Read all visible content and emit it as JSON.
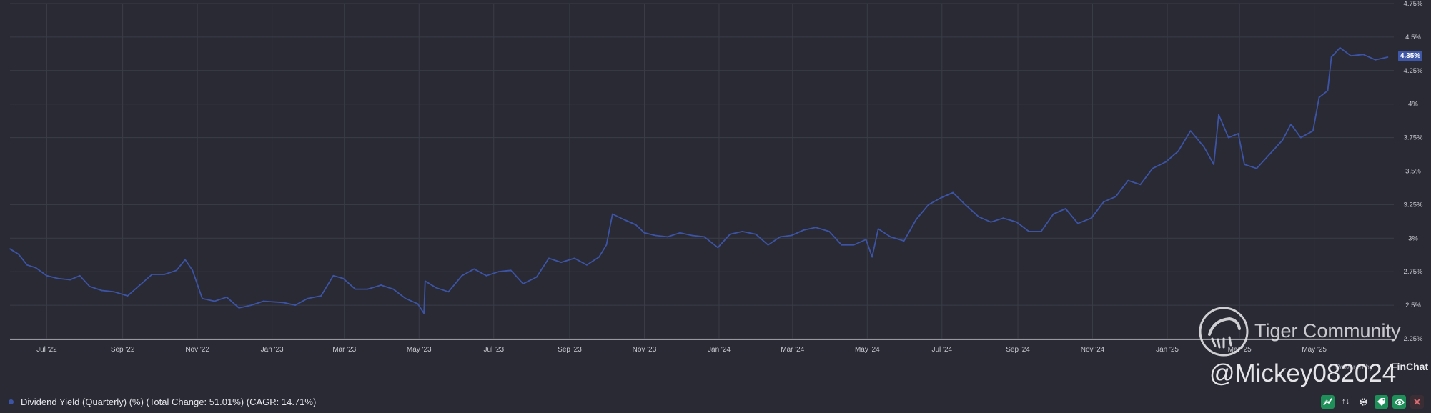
{
  "chart_data": {
    "type": "line",
    "series": [
      {
        "name": "Dividend Yield (Quarterly) (%)",
        "color": "#3d54a6",
        "points": [
          [
            "2022-06-01",
            2.92
          ],
          [
            "2022-06-08",
            2.88
          ],
          [
            "2022-06-15",
            2.8
          ],
          [
            "2022-06-22",
            2.78
          ],
          [
            "2022-07-01",
            2.72
          ],
          [
            "2022-07-10",
            2.7
          ],
          [
            "2022-07-20",
            2.69
          ],
          [
            "2022-07-28",
            2.72
          ],
          [
            "2022-08-05",
            2.64
          ],
          [
            "2022-08-15",
            2.61
          ],
          [
            "2022-08-25",
            2.6
          ],
          [
            "2022-09-05",
            2.57
          ],
          [
            "2022-09-15",
            2.65
          ],
          [
            "2022-09-25",
            2.73
          ],
          [
            "2022-10-05",
            2.73
          ],
          [
            "2022-10-15",
            2.76
          ],
          [
            "2022-10-22",
            2.84
          ],
          [
            "2022-10-28",
            2.76
          ],
          [
            "2022-11-05",
            2.55
          ],
          [
            "2022-11-15",
            2.53
          ],
          [
            "2022-11-25",
            2.56
          ],
          [
            "2022-12-05",
            2.48
          ],
          [
            "2022-12-15",
            2.5
          ],
          [
            "2022-12-25",
            2.53
          ],
          [
            "2023-01-10",
            2.52
          ],
          [
            "2023-01-20",
            2.5
          ],
          [
            "2023-01-30",
            2.55
          ],
          [
            "2023-02-10",
            2.57
          ],
          [
            "2023-02-20",
            2.72
          ],
          [
            "2023-02-28",
            2.7
          ],
          [
            "2023-03-10",
            2.62
          ],
          [
            "2023-03-20",
            2.62
          ],
          [
            "2023-03-31",
            2.65
          ],
          [
            "2023-04-10",
            2.62
          ],
          [
            "2023-04-20",
            2.55
          ],
          [
            "2023-04-30",
            2.51
          ],
          [
            "2023-05-05",
            2.44
          ],
          [
            "2023-05-06",
            2.68
          ],
          [
            "2023-05-15",
            2.63
          ],
          [
            "2023-05-25",
            2.6
          ],
          [
            "2023-06-05",
            2.72
          ],
          [
            "2023-06-15",
            2.77
          ],
          [
            "2023-06-25",
            2.72
          ],
          [
            "2023-07-05",
            2.75
          ],
          [
            "2023-07-15",
            2.76
          ],
          [
            "2023-07-25",
            2.66
          ],
          [
            "2023-08-05",
            2.71
          ],
          [
            "2023-08-15",
            2.85
          ],
          [
            "2023-08-25",
            2.82
          ],
          [
            "2023-09-05",
            2.85
          ],
          [
            "2023-09-15",
            2.8
          ],
          [
            "2023-09-25",
            2.86
          ],
          [
            "2023-10-01",
            2.95
          ],
          [
            "2023-10-06",
            3.18
          ],
          [
            "2023-10-15",
            3.14
          ],
          [
            "2023-10-25",
            3.1
          ],
          [
            "2023-11-01",
            3.04
          ],
          [
            "2023-11-10",
            3.02
          ],
          [
            "2023-11-20",
            3.01
          ],
          [
            "2023-11-30",
            3.04
          ],
          [
            "2023-12-10",
            3.02
          ],
          [
            "2023-12-20",
            3.01
          ],
          [
            "2023-12-31",
            2.93
          ],
          [
            "2024-01-10",
            3.03
          ],
          [
            "2024-01-20",
            3.05
          ],
          [
            "2024-01-31",
            3.03
          ],
          [
            "2024-02-10",
            2.95
          ],
          [
            "2024-02-20",
            3.01
          ],
          [
            "2024-02-29",
            3.02
          ],
          [
            "2024-03-10",
            3.06
          ],
          [
            "2024-03-20",
            3.08
          ],
          [
            "2024-03-31",
            3.05
          ],
          [
            "2024-04-10",
            2.95
          ],
          [
            "2024-04-20",
            2.95
          ],
          [
            "2024-04-30",
            2.99
          ],
          [
            "2024-05-05",
            2.86
          ],
          [
            "2024-05-10",
            3.07
          ],
          [
            "2024-05-20",
            3.01
          ],
          [
            "2024-05-31",
            2.98
          ],
          [
            "2024-06-10",
            3.14
          ],
          [
            "2024-06-20",
            3.25
          ],
          [
            "2024-06-30",
            3.3
          ],
          [
            "2024-07-10",
            3.34
          ],
          [
            "2024-07-20",
            3.25
          ],
          [
            "2024-07-31",
            3.16
          ],
          [
            "2024-08-10",
            3.12
          ],
          [
            "2024-08-20",
            3.15
          ],
          [
            "2024-08-31",
            3.12
          ],
          [
            "2024-09-10",
            3.05
          ],
          [
            "2024-09-20",
            3.05
          ],
          [
            "2024-09-30",
            3.18
          ],
          [
            "2024-10-10",
            3.22
          ],
          [
            "2024-10-20",
            3.11
          ],
          [
            "2024-10-31",
            3.15
          ],
          [
            "2024-11-10",
            3.27
          ],
          [
            "2024-11-20",
            3.31
          ],
          [
            "2024-11-30",
            3.43
          ],
          [
            "2024-12-10",
            3.4
          ],
          [
            "2024-12-20",
            3.52
          ],
          [
            "2024-12-31",
            3.57
          ],
          [
            "2025-01-10",
            3.65
          ],
          [
            "2025-01-20",
            3.8
          ],
          [
            "2025-01-31",
            3.68
          ],
          [
            "2025-02-08",
            3.55
          ],
          [
            "2025-02-12",
            3.92
          ],
          [
            "2025-02-20",
            3.75
          ],
          [
            "2025-02-28",
            3.78
          ],
          [
            "2025-03-05",
            3.55
          ],
          [
            "2025-03-15",
            3.52
          ],
          [
            "2025-03-25",
            3.62
          ],
          [
            "2025-04-05",
            3.73
          ],
          [
            "2025-04-12",
            3.85
          ],
          [
            "2025-04-20",
            3.75
          ],
          [
            "2025-04-30",
            3.8
          ],
          [
            "2025-05-05",
            4.05
          ],
          [
            "2025-05-12",
            4.1
          ],
          [
            "2025-05-15",
            4.35
          ],
          [
            "2025-05-22",
            4.42
          ],
          [
            "2025-05-31",
            4.36
          ],
          [
            "2025-06-10",
            4.37
          ],
          [
            "2025-06-20",
            4.33
          ],
          [
            "2025-06-30",
            4.35
          ]
        ]
      }
    ],
    "x_ticks": [
      "Jul '22",
      "Sep '22",
      "Nov '22",
      "Jan '23",
      "Mar '23",
      "May '23",
      "Jul '23",
      "Sep '23",
      "Nov '23",
      "Jan '24",
      "Mar '24",
      "May '24",
      "Jul '24",
      "Sep '24",
      "Nov '24",
      "Jan '25",
      "Mar '25",
      "May '25"
    ],
    "x_tick_dates": [
      "2022-07-01",
      "2022-09-01",
      "2022-11-01",
      "2023-01-01",
      "2023-03-01",
      "2023-05-01",
      "2023-07-01",
      "2023-09-01",
      "2023-11-01",
      "2024-01-01",
      "2024-03-01",
      "2024-05-01",
      "2024-07-01",
      "2024-09-01",
      "2024-11-01",
      "2025-01-01",
      "2025-03-01",
      "2025-05-01"
    ],
    "y_ticks": [
      "2.25%",
      "2.5%",
      "2.75%",
      "3%",
      "3.25%",
      "3.5%",
      "3.75%",
      "4%",
      "4.25%",
      "4.5%",
      "4.75%"
    ],
    "y_tick_values": [
      2.25,
      2.5,
      2.75,
      3.0,
      3.25,
      3.5,
      3.75,
      4.0,
      4.25,
      4.5,
      4.75
    ],
    "ylim": [
      2.25,
      4.75
    ],
    "xlim": [
      "2022-06-01",
      "2025-07-05"
    ],
    "grid": true,
    "last_value_label": "4.35%",
    "legend_text": "Dividend Yield (Quarterly) (%) (Total Change: 51.01%) (CAGR: 14.71%)"
  },
  "watermark": {
    "community": "Tiger Community",
    "user": "@Mickey082024"
  },
  "powered_by": "Powered by",
  "brand": "FinChat",
  "toolbar": {
    "sort_icon_text": "↑↓"
  },
  "colors": {
    "background": "#292a33",
    "line": "#3d54a6",
    "grid": "#3a3c47",
    "axis_text": "#c8c9d1"
  }
}
